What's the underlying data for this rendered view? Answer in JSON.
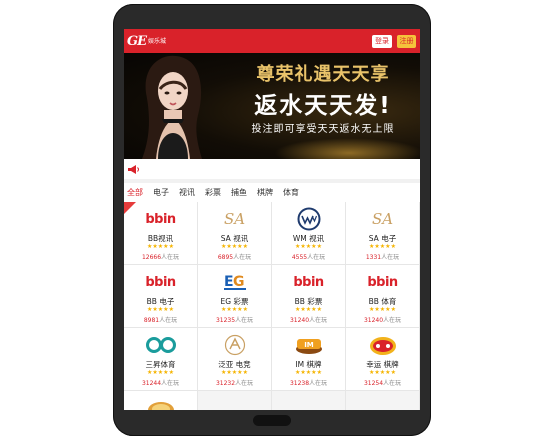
{
  "header": {
    "logo": "GE",
    "logo_sub": "娱乐城",
    "login": "登录",
    "register": "注册"
  },
  "banner": {
    "line1": "尊荣礼遇天天享",
    "line2": "返水天天发!",
    "line3": "投注即可享受天天返水无上限"
  },
  "tabs": [
    "全部",
    "电子",
    "视讯",
    "彩票",
    "捕鱼",
    "棋牌",
    "体育"
  ],
  "games": [
    {
      "name": "BB视讯",
      "online": "12666",
      "logo": "bbin-logo"
    },
    {
      "name": "SA 视讯",
      "online": "6895",
      "logo": "sa-logo"
    },
    {
      "name": "WM 视讯",
      "online": "4555",
      "logo": "wm-logo"
    },
    {
      "name": "SA 电子",
      "online": "1331",
      "logo": "sa-logo"
    },
    {
      "name": "BB 电子",
      "online": "8981",
      "logo": "bbin-logo"
    },
    {
      "name": "EG 彩票",
      "online": "31235",
      "logo": "eg-logo"
    },
    {
      "name": "BB 彩票",
      "online": "31240",
      "logo": "bbin-logo"
    },
    {
      "name": "BB 体育",
      "online": "31240",
      "logo": "bbin-logo"
    },
    {
      "name": "三昇体育",
      "online": "31244",
      "logo": "sansheng-logo"
    },
    {
      "name": "泛亚 电竞",
      "online": "31232",
      "logo": "fanya-logo"
    },
    {
      "name": "IM 棋牌",
      "online": "31238",
      "logo": "im-chess-logo"
    },
    {
      "name": "幸运 棋牌",
      "online": "31254",
      "logo": "lucky-chess-logo"
    }
  ],
  "online_suffix": "人在玩",
  "stars": "★★★★★",
  "colors": {
    "brand_red": "#d9222a",
    "gold": "#e9c36a",
    "star": "#f5b400"
  }
}
